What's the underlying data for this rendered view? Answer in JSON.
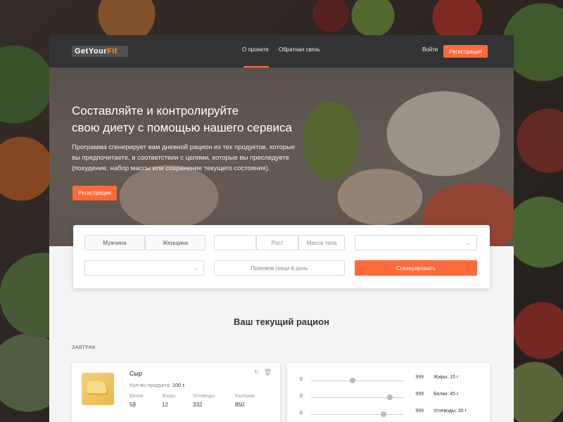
{
  "nav": {
    "logo_main": "GetYour",
    "logo_accent": "Fit",
    "about": "О проекте",
    "feedback": "Обратная связь",
    "login": "Войти",
    "register": "Регистрация"
  },
  "hero": {
    "title_line1": "Составляйте и контролируйте",
    "title_line2": "свою диету с помощью нашего сервиса",
    "text_line1": "Программа сгенерирует вам дневной рацион из тех продуктов, которые",
    "text_line2": "вы предпочитаете, в соответствии с целями, которые вы преследуете",
    "text_line3": "(похудение, набор массы или сохранение текущего состояния).",
    "cta": "Регистрация"
  },
  "filter": {
    "male": "Мужчина",
    "female": "Женщина",
    "age": "",
    "height": "Рост",
    "weight": "Масса тела",
    "goal": "",
    "activity": "",
    "meals": "Приемов пищи в день",
    "generate": "Сгенерировать"
  },
  "ration": {
    "title": "Ваш текущий рацион",
    "meal": "ЗАВТРАК"
  },
  "product": {
    "name": "Сыр",
    "qty_label": "Кол-во продукта:",
    "qty_value": "100 г.",
    "protein_label": "Белки",
    "protein_value": "58",
    "fat_label": "Жиры",
    "fat_value": "12",
    "carbs_label": "Углеводы",
    "carbs_value": "332",
    "cal_label": "Калории",
    "cal_value": "850"
  },
  "sliders": [
    {
      "min": "0",
      "max": "999",
      "stat": "Жиры: 15 г",
      "level": 0.45
    },
    {
      "min": "0",
      "max": "999",
      "stat": "Белки: 45 г",
      "level": 0.85
    },
    {
      "min": "0",
      "max": "999",
      "stat": "Углеводы: 30 г",
      "level": 0.78
    }
  ]
}
